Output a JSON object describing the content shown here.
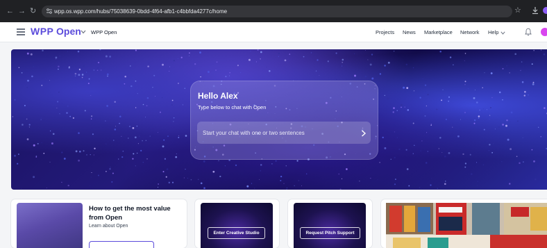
{
  "browser": {
    "url": "wpp.os.wpp.com/hubs/75038639-0bdd-4f64-afb1-c4bbfda4277c/home",
    "back_icon": "arrow-left-icon",
    "forward_icon": "arrow-right-icon",
    "reload_icon": "reload-icon"
  },
  "header": {
    "logo_primary": "WPP",
    "logo_secondary": "Open",
    "workspace": "WPP Open",
    "nav": [
      "Projects",
      "News",
      "Marketplace",
      "Network",
      "Help"
    ],
    "accent_color": "#5b4bdb"
  },
  "hero": {
    "greeting": "Hello Alex",
    "subtitle": "Type below to chat with Open",
    "chat_placeholder": "Start your chat with one or two sentences"
  },
  "cards": {
    "learn": {
      "title": "How to get the most value from Open",
      "subtitle": "Learn about Open"
    },
    "creative_studio_label": "Enter Creative Studio",
    "pitch_support_label": "Request Pitch Support"
  }
}
